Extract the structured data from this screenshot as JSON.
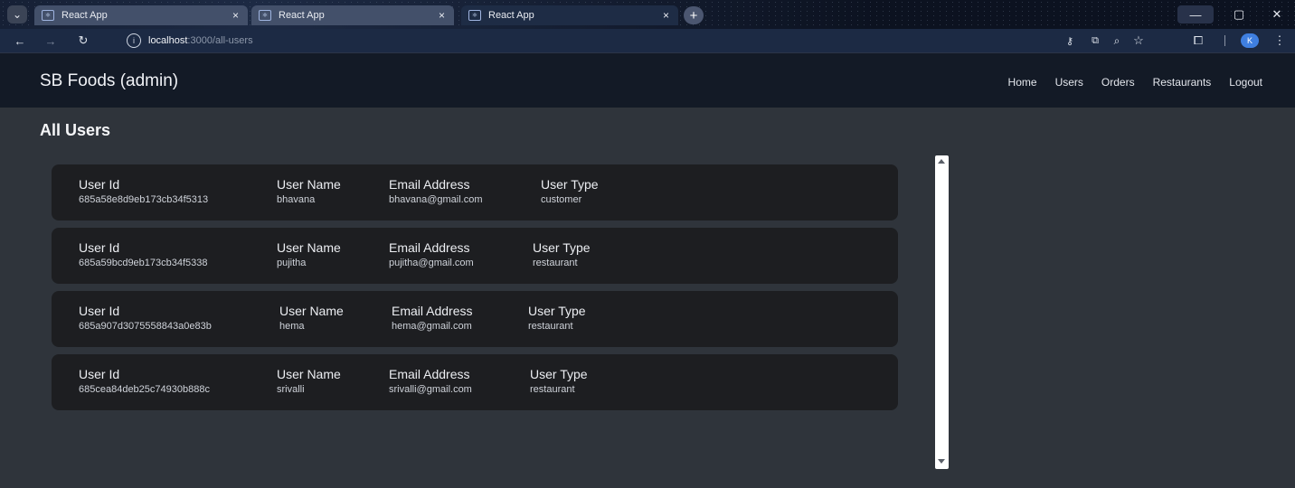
{
  "browser": {
    "tabs": [
      {
        "title": "React App",
        "favicon": "react-logo-icon",
        "active": false
      },
      {
        "title": "React App",
        "favicon": "react-logo-icon",
        "active": false
      },
      {
        "title": "React App",
        "favicon": "react-logo-icon",
        "active": true
      }
    ],
    "new_tab_glyph": "+",
    "close_glyph": "×",
    "address": {
      "host": "localhost",
      "path": ":3000/all-users"
    },
    "profile_initial": "K",
    "controls": {
      "minimize": "—",
      "maximize": "▢",
      "close": "✕"
    }
  },
  "navbar": {
    "brand": "SB Foods (admin)",
    "links": [
      "Home",
      "Users",
      "Orders",
      "Restaurants",
      "Logout"
    ]
  },
  "page": {
    "title": "All Users",
    "labels": {
      "id": "User Id",
      "name": "User Name",
      "email": "Email Address",
      "type": "User Type"
    },
    "users": [
      {
        "id": "685a58e8d9eb173cb34f5313",
        "name": "bhavana",
        "email": "bhavana@gmail.com",
        "type": "customer"
      },
      {
        "id": "685a59bcd9eb173cb34f5338",
        "name": "pujitha",
        "email": "pujitha@gmail.com",
        "type": "restaurant"
      },
      {
        "id": "685a907d3075558843a0e83b",
        "name": "hema",
        "email": "hema@gmail.com",
        "type": "restaurant"
      },
      {
        "id": "685cea84deb25c74930b888c",
        "name": "srivalli",
        "email": "srivalli@gmail.com",
        "type": "restaurant"
      }
    ]
  },
  "colors": {
    "page_bg": "#2f343b",
    "navbar_bg": "#131a26",
    "card_bg": "#1d1e21"
  }
}
